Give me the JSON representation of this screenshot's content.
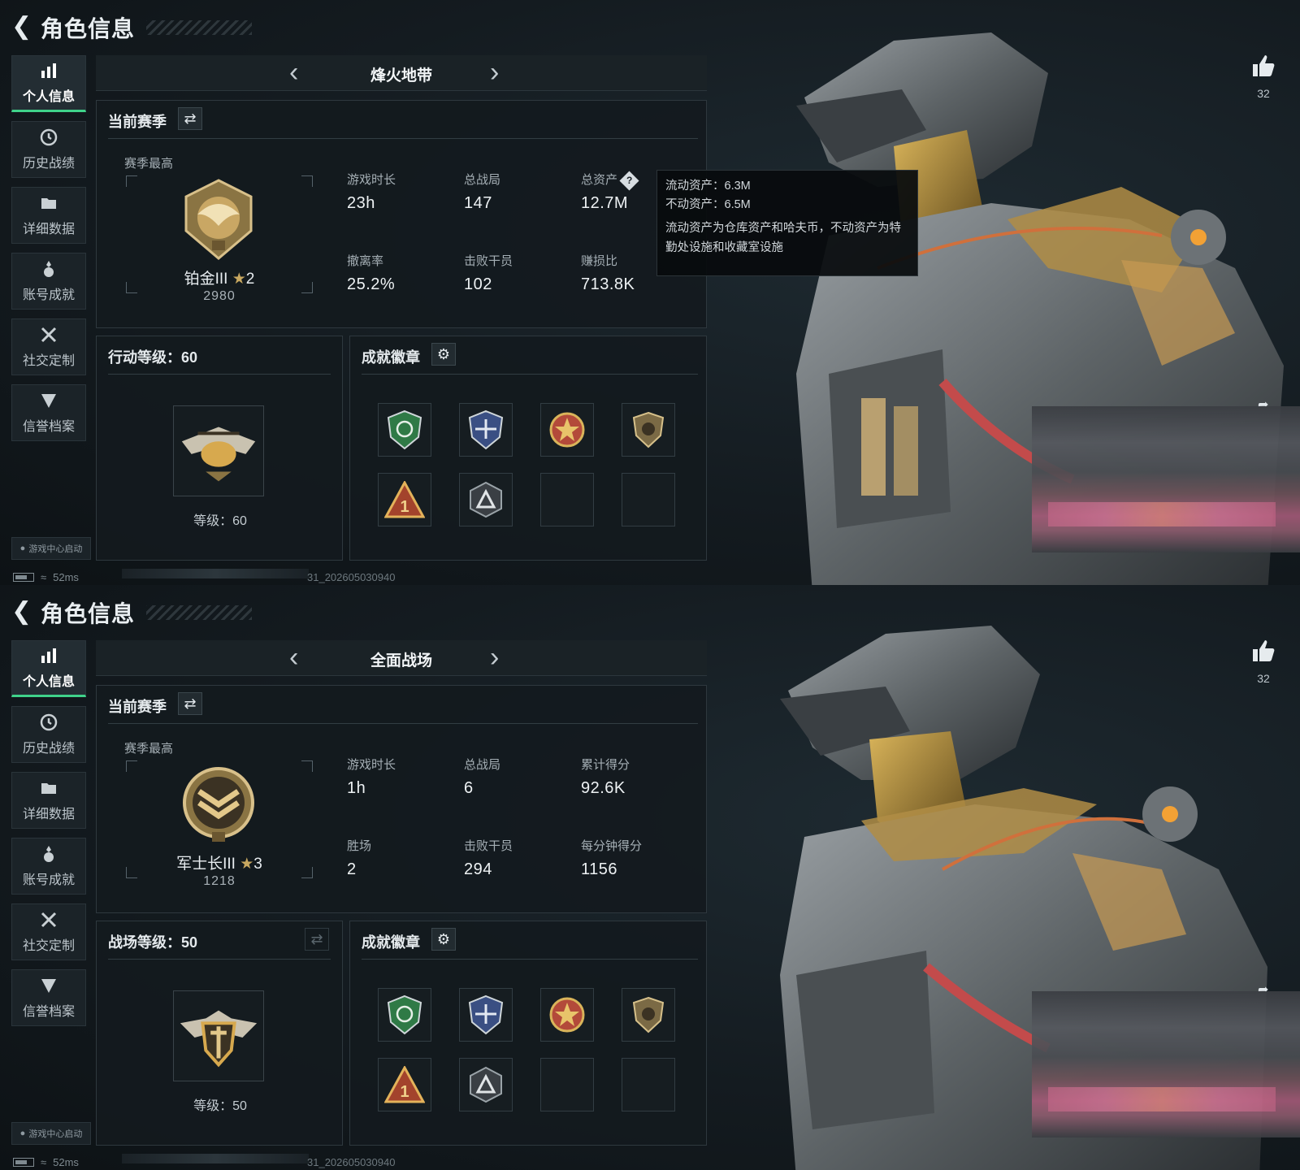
{
  "screens": [
    {
      "header": {
        "title": "角色信息"
      },
      "sidebar": {
        "items": [
          {
            "label": "个人信息",
            "icon": "bar-chart-icon"
          },
          {
            "label": "历史战绩",
            "icon": "history-clock-icon"
          },
          {
            "label": "详细数据",
            "icon": "folder-icon"
          },
          {
            "label": "账号成就",
            "icon": "medal-icon"
          },
          {
            "label": "社交定制",
            "icon": "tools-icon"
          },
          {
            "label": "信誉档案",
            "icon": "shield-badge-icon"
          }
        ],
        "game_center": "游戏中心启动"
      },
      "status": {
        "ping": "52ms",
        "build": "31_202605030940"
      },
      "mode": {
        "name": "烽火地带"
      },
      "season": {
        "title": "当前赛季",
        "subtitle": "赛季最高",
        "rank": {
          "name": "铂金III",
          "stars": "2",
          "score": "2980"
        },
        "stats": [
          {
            "label": "游戏时长",
            "value": "23h"
          },
          {
            "label": "总战局",
            "value": "147"
          },
          {
            "label": "总资产",
            "value": "12.7M"
          },
          {
            "label": "撤离率",
            "value": "25.2%"
          },
          {
            "label": "击败干员",
            "value": "102"
          },
          {
            "label": "赚损比",
            "value": "713.8K"
          }
        ]
      },
      "tooltip": {
        "line1": "流动资产：6.3M",
        "line2": "不动资产：6.5M",
        "desc": "流动资产为仓库资产和哈夫币，不动资产为特勤处设施和收藏室设施"
      },
      "level": {
        "title": "行动等级：60",
        "label": "等级：60"
      },
      "badges": {
        "title": "成就徽章"
      },
      "likes": "32",
      "colors": {
        "accent": "#3fd28a",
        "gold": "#c8a860"
      }
    },
    {
      "header": {
        "title": "角色信息"
      },
      "sidebar": {
        "items": [
          {
            "label": "个人信息",
            "icon": "bar-chart-icon"
          },
          {
            "label": "历史战绩",
            "icon": "history-clock-icon"
          },
          {
            "label": "详细数据",
            "icon": "folder-icon"
          },
          {
            "label": "账号成就",
            "icon": "medal-icon"
          },
          {
            "label": "社交定制",
            "icon": "tools-icon"
          },
          {
            "label": "信誉档案",
            "icon": "shield-badge-icon"
          }
        ],
        "game_center": "游戏中心启动"
      },
      "status": {
        "ping": "52ms",
        "build": "31_202605030940"
      },
      "mode": {
        "name": "全面战场"
      },
      "season": {
        "title": "当前赛季",
        "subtitle": "赛季最高",
        "rank": {
          "name": "军士长III",
          "stars": "3",
          "score": "1218"
        },
        "stats": [
          {
            "label": "游戏时长",
            "value": "1h"
          },
          {
            "label": "总战局",
            "value": "6"
          },
          {
            "label": "累计得分",
            "value": "92.6K"
          },
          {
            "label": "胜场",
            "value": "2"
          },
          {
            "label": "击败干员",
            "value": "294"
          },
          {
            "label": "每分钟得分",
            "value": "1156"
          }
        ]
      },
      "level": {
        "title": "战场等级：50",
        "label": "等级：50"
      },
      "badges": {
        "title": "成就徽章"
      },
      "likes": "32",
      "colors": {
        "accent": "#3fd28a",
        "gold": "#c8a860"
      }
    }
  ]
}
